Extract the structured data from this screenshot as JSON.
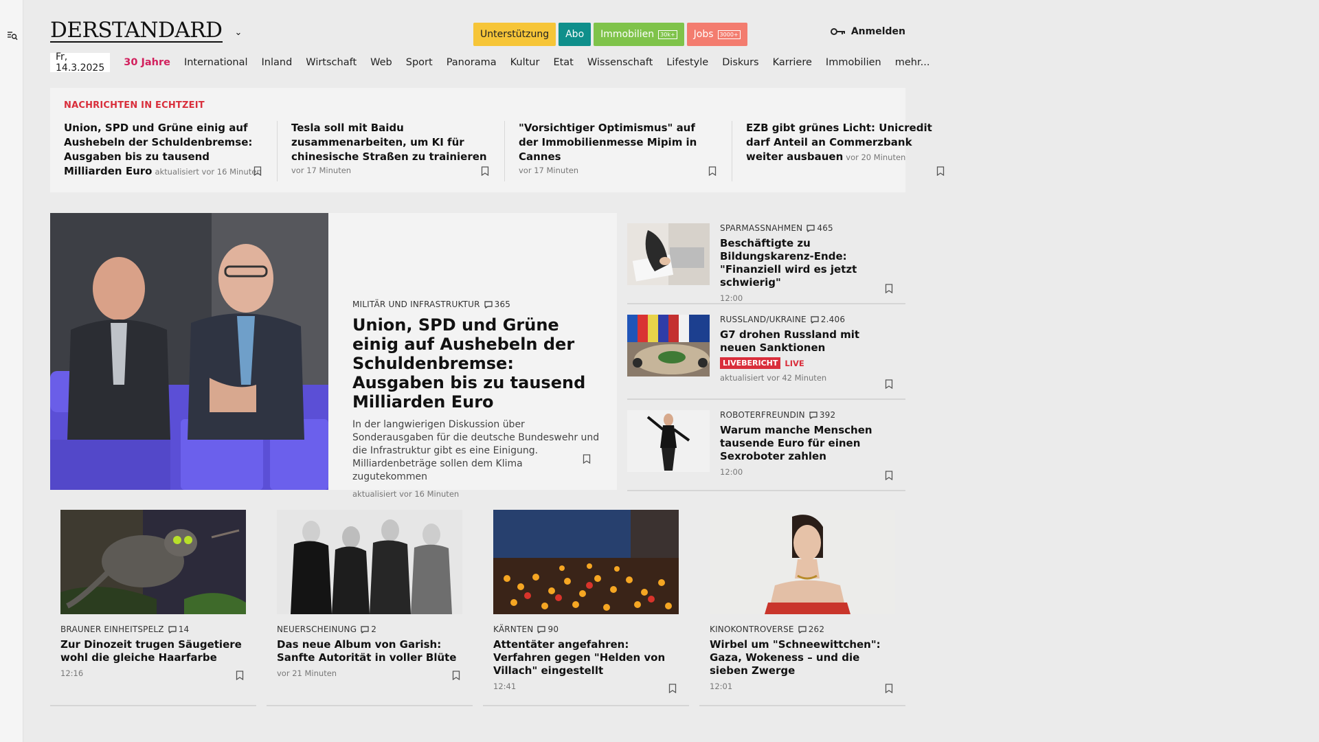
{
  "header": {
    "logo": "DERSTANDARD",
    "pills": [
      {
        "label": "Unterstützung",
        "badge": ""
      },
      {
        "label": "Abo",
        "badge": ""
      },
      {
        "label": "Immobilien",
        "badge": "30k+"
      },
      {
        "label": "Jobs",
        "badge": "3000+"
      }
    ],
    "login_label": "Anmelden"
  },
  "nav": {
    "date": "Fr, 14.3.2025",
    "items": [
      "30 Jahre",
      "International",
      "Inland",
      "Wirtschaft",
      "Web",
      "Sport",
      "Panorama",
      "Kultur",
      "Etat",
      "Wissenschaft",
      "Lifestyle",
      "Diskurs",
      "Karriere",
      "Immobilien",
      "mehr..."
    ]
  },
  "realtime": {
    "title": "NACHRICHTEN IN ECHTZEIT",
    "items": [
      {
        "headline": "Union, SPD und Grüne einig auf Aushebeln der Schuldenbremse: Ausgaben bis zu tausend Milliarden Euro",
        "time": "aktualisiert vor 16 Minuten"
      },
      {
        "headline": "Tesla soll mit Baidu zusammenarbeiten, um KI für chinesische Straßen zu trainieren",
        "time": "vor 17 Minuten"
      },
      {
        "headline": "\"Vorsichtiger Optimismus\" auf der Immobilienmesse Mipim in Cannes",
        "time": "vor 17 Minuten"
      },
      {
        "headline": "EZB gibt grünes Licht: Unicredit darf Anteil an Commerzbank weiter ausbauen",
        "time": "vor 20 Minuten"
      }
    ]
  },
  "hero": {
    "kicker": "MILITÄR UND INFRASTRUKTUR",
    "comments": "365",
    "headline": "Union, SPD und Grüne einig auf Aushebeln der Schuldenbremse: Ausgaben bis zu tausend Milliarden Euro",
    "teaser": "In der langwierigen Diskussion über Sonderausgaben für die deutsche Bundeswehr und die Infrastruktur gibt es eine Einigung. Milliardenbeträge sollen dem Klima zugutekommen",
    "time": "aktualisiert vor 16 Minuten"
  },
  "side": [
    {
      "kicker": "SPARMASSNAHMEN",
      "comments": "465",
      "headline": "Beschäftigte zu Bildungskarenz-Ende: \"Finanziell wird es jetzt schwierig\"",
      "time": "12:00"
    },
    {
      "kicker": "RUSSLAND/UKRAINE",
      "comments": "2.406",
      "headline": "G7 drohen Russland mit neuen Sanktionen",
      "live_badge": "LIVEBERICHT",
      "live_label": "LIVE",
      "time": "aktualisiert vor 42 Minuten"
    },
    {
      "kicker": "ROBOTERFREUNDIN",
      "comments": "392",
      "headline": "Warum manche Menschen tausende Euro für einen Sexroboter zahlen",
      "time": "12:00"
    }
  ],
  "cards": [
    {
      "kicker": "BRAUNER EINHEITSPELZ",
      "comments": "14",
      "headline": "Zur Dinozeit trugen Säugetiere wohl die gleiche Haarfarbe",
      "time": "12:16"
    },
    {
      "kicker": "NEUERSCHEINUNG",
      "comments": "2",
      "headline": "Das neue Album von Garish: Sanfte Autorität in voller Blüte",
      "time": "vor 21 Minuten"
    },
    {
      "kicker": "KÄRNTEN",
      "comments": "90",
      "headline": "Attentäter angefahren: Verfahren gegen \"Helden von Villach\" eingestellt",
      "time": "12:41"
    },
    {
      "kicker": "KINOKONTROVERSE",
      "comments": "262",
      "headline": "Wirbel um \"Schneewittchen\": Gaza, Wokeness – und die sieben Zwerge",
      "time": "12:01"
    }
  ],
  "colors": {
    "accent_pink": "#d2205d",
    "red": "#d92e3b",
    "teal": "#0f8f8b",
    "green": "#7fc34a",
    "salmon": "#f37c6f",
    "yellow": "#f6c538"
  }
}
